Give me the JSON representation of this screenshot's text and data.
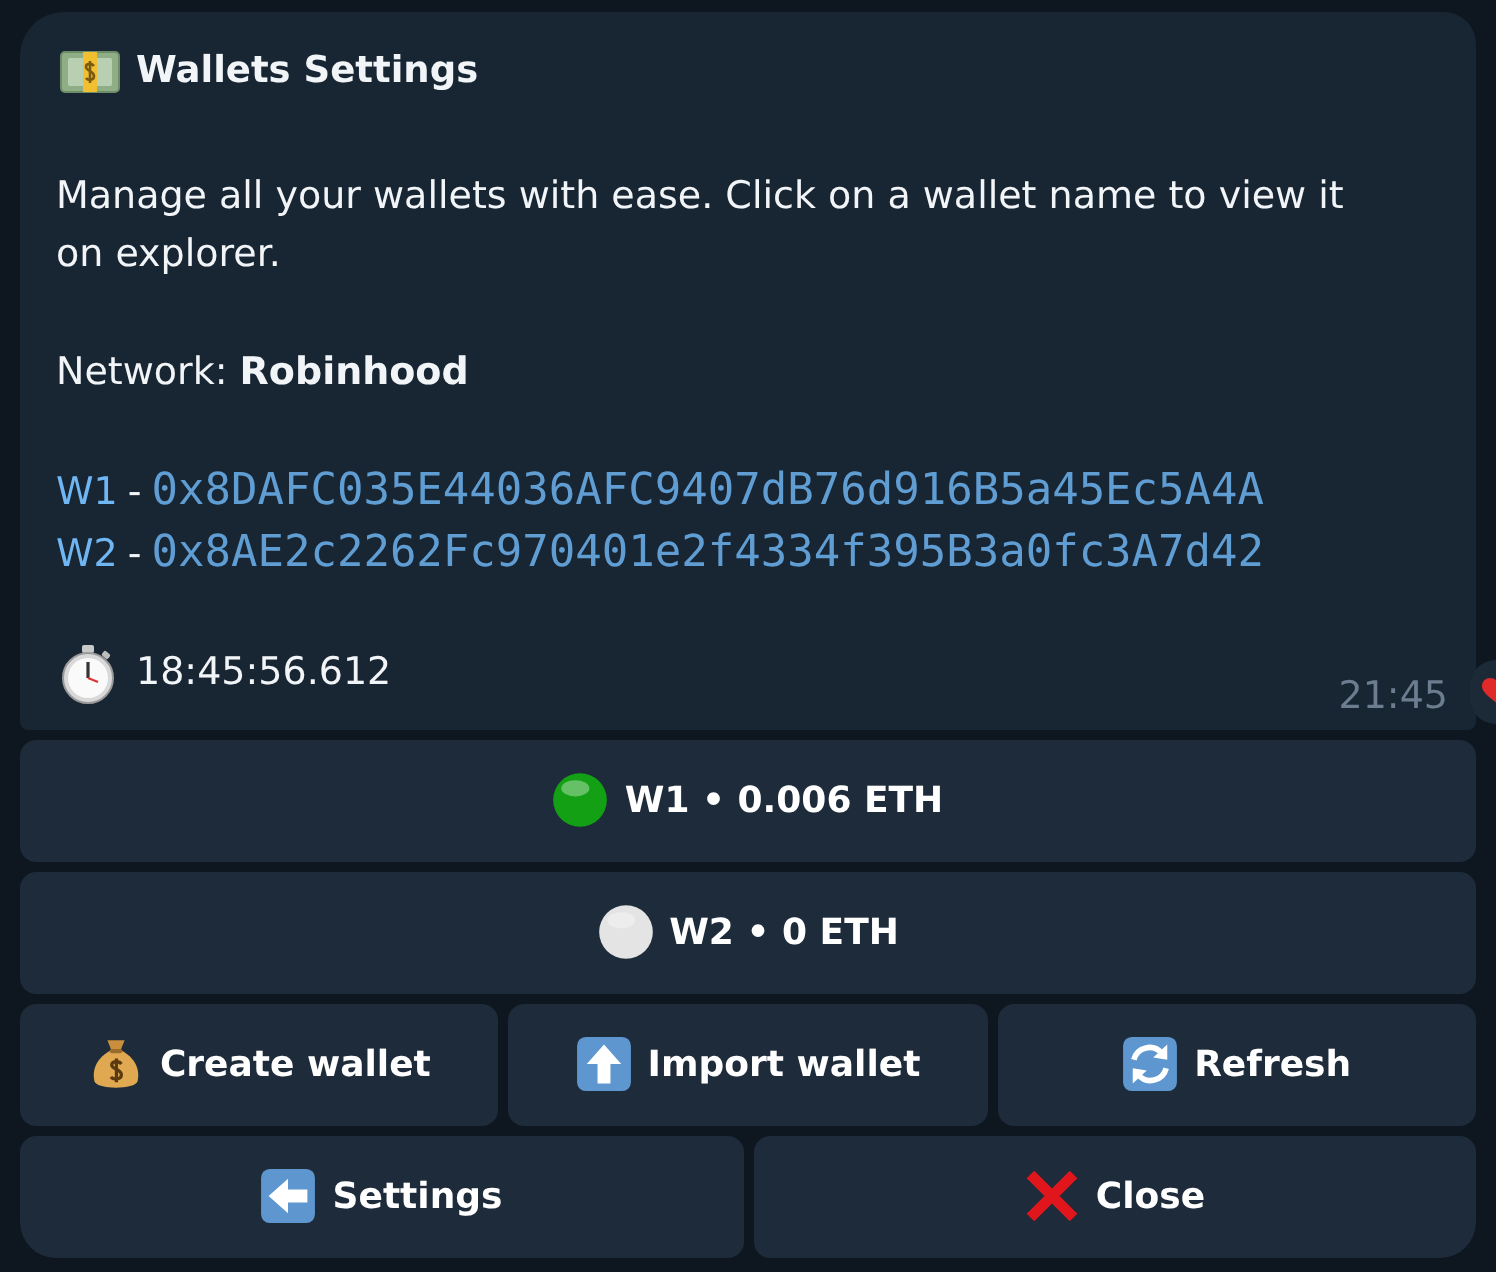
{
  "message": {
    "title": "Wallets Settings",
    "description": "Manage all your wallets with ease. Click on a wallet name to view it on explorer.",
    "network": "Network: **Robinhood**",
    "wallets": [
      {
        "name": "W1",
        "separator": "-",
        "address": "0x8DAFC035E44036AFC9407dB76d916B5a45Ec5A4A"
      },
      {
        "name": "W2",
        "separator": "-",
        "address": "0x8AE2c2262Fc970401e2f4334f395B3a0fc3A7d42"
      }
    ],
    "timer": "18:45:56.612",
    "time": "21:45"
  },
  "keyboard": {
    "wallet_buttons": [
      {
        "label": "W1 • 0.006 ETH",
        "color": "#14a014"
      },
      {
        "label": "W2 • 0 ETH",
        "color": "#e4e4e4"
      }
    ],
    "action_rows": [
      [
        {
          "label": "Create wallet",
          "kind": "money"
        },
        {
          "label": "Import wallet",
          "kind": "upload"
        },
        {
          "label": "Refresh",
          "kind": "refresh"
        }
      ],
      [
        {
          "label": "Settings",
          "kind": "back"
        },
        {
          "label": "Close",
          "kind": "close"
        }
      ]
    ]
  }
}
